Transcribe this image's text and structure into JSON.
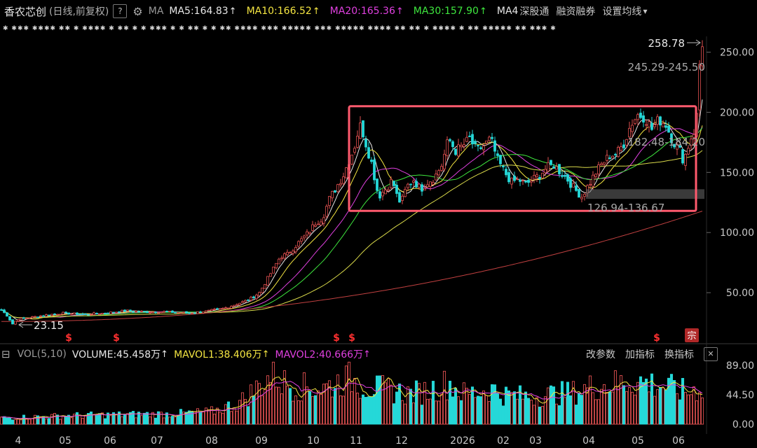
{
  "header": {
    "stock_name": "香农芯创",
    "period_info": "(日线,前复权)",
    "help_icon": "?",
    "settings_icon": "gear-icon",
    "ma_label": "MA",
    "ma_items": [
      {
        "label": "MA5:164.83",
        "arrow": "↑",
        "color": "#e8e8e8"
      },
      {
        "label": "MA10:166.52",
        "arrow": "↑",
        "color": "#f5e642"
      },
      {
        "label": "MA20:165.36",
        "arrow": "↑",
        "color": "#e040e0"
      },
      {
        "label": "MA30:157.90",
        "arrow": "↑",
        "color": "#3ee63e"
      },
      {
        "label": "MA4",
        "arrow": "",
        "color": "#e8e8e8"
      }
    ],
    "toolbar": [
      "深股通",
      "融资融券",
      "设置均线"
    ],
    "dropdown_icon": "▾"
  },
  "star_markers": "✱ ✱✱✱  ✱✱✱✱ ✱✱  ✱  ✱✱✱✱ ✱   ✱✱ ✱  ✱     ✱✱✱  ✱  ✱    ✱✱ ✱  ✱      ✱✱  ✱✱✱✱ ✱✱✱  ✱✱✱✱✱ ✱✱✱ ✱✱✱✱✱ ✱✱✱✱ ✱✱ ✱✱ ✱ ✱✱✱✱ ✱  ✱✱ ✱✱✱✱✱ ✱✱ ✱✱✱ ✱",
  "volume_header": {
    "collapse_icon": "⊟",
    "vol_label": "VOL(5,10)",
    "volume": "VOLUME:45.458万",
    "volume_arrow": "↑",
    "mavol1": "MAVOL1:38.406万",
    "mavol1_arrow": "↑",
    "mavol2": "MAVOL2:40.666万",
    "mavol2_arrow": "↑",
    "buttons": [
      "改参数",
      "加指标",
      "换指标"
    ],
    "close_icon": "✕"
  },
  "annotations": {
    "price_max": "258.78",
    "price_min": "23.15",
    "zone_upper": "245.29-245.50",
    "zone_mid": "182.48-184.20",
    "zone_lower": "126.94-136.67",
    "event_markers": [
      "$",
      "$",
      "$",
      "$",
      "$"
    ],
    "badge": "宗"
  },
  "chart_data": {
    "type": "line",
    "price_axis": {
      "ticks": [
        50,
        100,
        150,
        200,
        250
      ],
      "tick_labels": [
        "50.00",
        "100.00",
        "150.00",
        "200.00",
        "250.00"
      ],
      "ylim": [
        0,
        265
      ]
    },
    "volume_axis": {
      "ticks": [
        0,
        44.5,
        89
      ],
      "tick_labels": [
        "0.00",
        "44.50",
        "89.00"
      ],
      "ylim": [
        0,
        95
      ]
    },
    "x_labels": [
      "4",
      "05",
      "06",
      "07",
      "08",
      "09",
      "10",
      "11",
      "12",
      "2026",
      "02",
      "03",
      "04",
      "05",
      "06"
    ],
    "close": [
      [
        0,
        37
      ],
      [
        10,
        31
      ],
      [
        18,
        24
      ],
      [
        25,
        28
      ],
      [
        40,
        29
      ],
      [
        60,
        31
      ],
      [
        90,
        33
      ],
      [
        120,
        32
      ],
      [
        150,
        33
      ],
      [
        180,
        35
      ],
      [
        210,
        34
      ],
      [
        240,
        34
      ],
      [
        270,
        33
      ],
      [
        300,
        35
      ],
      [
        320,
        37
      ],
      [
        340,
        41
      ],
      [
        355,
        44
      ],
      [
        370,
        50
      ],
      [
        380,
        60
      ],
      [
        390,
        70
      ],
      [
        400,
        80
      ],
      [
        410,
        82
      ],
      [
        420,
        88
      ],
      [
        430,
        94
      ],
      [
        440,
        100
      ],
      [
        450,
        108
      ],
      [
        460,
        112
      ],
      [
        470,
        128
      ],
      [
        480,
        138
      ],
      [
        490,
        148
      ],
      [
        498,
        160
      ],
      [
        505,
        170
      ],
      [
        510,
        182
      ],
      [
        515,
        190
      ],
      [
        520,
        178
      ],
      [
        530,
        158
      ],
      [
        540,
        130
      ],
      [
        550,
        136
      ],
      [
        560,
        144
      ],
      [
        565,
        132
      ],
      [
        572,
        124
      ],
      [
        580,
        138
      ],
      [
        590,
        144
      ],
      [
        600,
        136
      ],
      [
        610,
        142
      ],
      [
        620,
        146
      ],
      [
        630,
        156
      ],
      [
        640,
        178
      ],
      [
        650,
        168
      ],
      [
        660,
        172
      ],
      [
        670,
        178
      ],
      [
        680,
        168
      ],
      [
        690,
        172
      ],
      [
        700,
        178
      ],
      [
        710,
        160
      ],
      [
        720,
        150
      ],
      [
        730,
        142
      ],
      [
        740,
        144
      ],
      [
        750,
        140
      ],
      [
        760,
        144
      ],
      [
        770,
        148
      ],
      [
        780,
        154
      ],
      [
        790,
        156
      ],
      [
        800,
        150
      ],
      [
        810,
        144
      ],
      [
        820,
        136
      ],
      [
        830,
        130
      ],
      [
        840,
        140
      ],
      [
        850,
        150
      ],
      [
        860,
        158
      ],
      [
        870,
        164
      ],
      [
        880,
        166
      ],
      [
        890,
        174
      ],
      [
        900,
        190
      ],
      [
        910,
        198
      ],
      [
        920,
        196
      ],
      [
        930,
        186
      ],
      [
        940,
        194
      ],
      [
        950,
        190
      ],
      [
        960,
        176
      ],
      [
        970,
        168
      ],
      [
        975,
        160
      ],
      [
        980,
        168
      ],
      [
        985,
        178
      ],
      [
        990,
        184
      ],
      [
        995,
        200
      ],
      [
        998,
        240
      ],
      [
        1002,
        258
      ]
    ],
    "ma_lines": [
      {
        "name": "MA5",
        "color": "#e8e8e8"
      },
      {
        "name": "MA10",
        "color": "#f5e642"
      },
      {
        "name": "MA20",
        "color": "#e040e0"
      },
      {
        "name": "MA30",
        "color": "#3ee63e"
      },
      {
        "name": "MA60",
        "color": "#d9d94a"
      },
      {
        "name": "MA250",
        "color": "#c04040"
      }
    ],
    "highlight_box": {
      "x_range": [
        498,
        993
      ],
      "price_range": [
        118,
        205
      ]
    },
    "support_band": {
      "x_range": [
        836,
        1005
      ],
      "price_range": [
        128,
        136
      ]
    },
    "volume_profile": [
      [
        0,
        10
      ],
      [
        50,
        12
      ],
      [
        100,
        14
      ],
      [
        150,
        15
      ],
      [
        200,
        16
      ],
      [
        250,
        17
      ],
      [
        300,
        20
      ],
      [
        340,
        34
      ],
      [
        370,
        62
      ],
      [
        385,
        78
      ],
      [
        390,
        88
      ],
      [
        400,
        70
      ],
      [
        420,
        62
      ],
      [
        440,
        60
      ],
      [
        460,
        58
      ],
      [
        480,
        68
      ],
      [
        500,
        75
      ],
      [
        520,
        62
      ],
      [
        540,
        58
      ],
      [
        560,
        55
      ],
      [
        580,
        50
      ],
      [
        600,
        52
      ],
      [
        620,
        58
      ],
      [
        640,
        68
      ],
      [
        660,
        50
      ],
      [
        680,
        52
      ],
      [
        700,
        58
      ],
      [
        720,
        48
      ],
      [
        740,
        46
      ],
      [
        760,
        45
      ],
      [
        780,
        48
      ],
      [
        800,
        50
      ],
      [
        820,
        52
      ],
      [
        840,
        60
      ],
      [
        860,
        64
      ],
      [
        880,
        66
      ],
      [
        900,
        70
      ],
      [
        920,
        68
      ],
      [
        940,
        64
      ],
      [
        960,
        58
      ],
      [
        980,
        52
      ],
      [
        1000,
        60
      ]
    ],
    "colors": {
      "up": "#e05050",
      "down": "#25d8d8",
      "box": "#ff5a6e",
      "band": "#6a6a6a"
    }
  }
}
